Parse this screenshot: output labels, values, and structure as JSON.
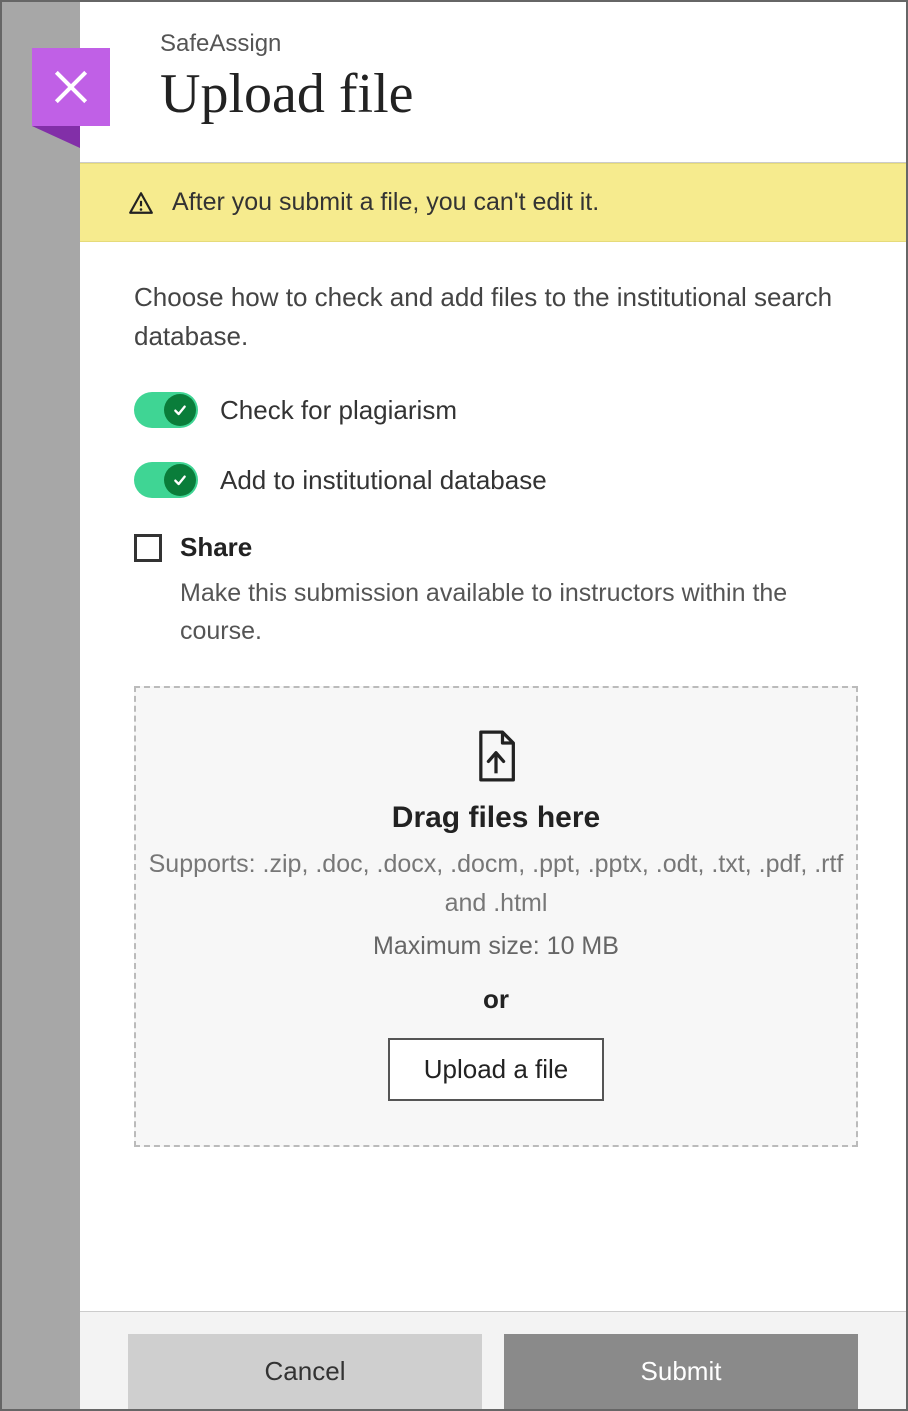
{
  "header": {
    "overline": "SafeAssign",
    "title": "Upload file"
  },
  "warning": {
    "text": "After you submit a file, you can't edit it."
  },
  "intro": "Choose how to check and add files to the institutional search database.",
  "options": {
    "plagiarism": {
      "label": "Check for plagiarism",
      "on": true
    },
    "institutional": {
      "label": "Add to institutional database",
      "on": true
    },
    "share": {
      "label": "Share",
      "checked": false,
      "description": "Make this submission available to instructors within the course."
    }
  },
  "dropzone": {
    "title": "Drag files here",
    "supports": "Supports: .zip, .doc, .docx, .docm, .ppt, .pptx, .odt, .txt, .pdf, .rtf and .html",
    "maxsize": "Maximum size: 10 MB",
    "or": "or",
    "upload_label": "Upload a file"
  },
  "footer": {
    "cancel": "Cancel",
    "submit": "Submit"
  }
}
